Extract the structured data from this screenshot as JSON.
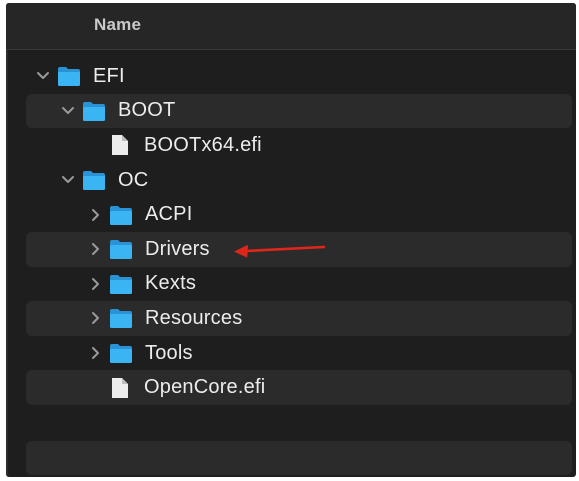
{
  "header": {
    "name_label": "Name"
  },
  "tree": [
    {
      "label": "EFI",
      "type": "folder",
      "expanded": true,
      "level": 0
    },
    {
      "label": "BOOT",
      "type": "folder",
      "expanded": true,
      "level": 1
    },
    {
      "label": "BOOTx64.efi",
      "type": "file",
      "level": 2
    },
    {
      "label": "OC",
      "type": "folder",
      "expanded": true,
      "level": 1
    },
    {
      "label": "ACPI",
      "type": "folder",
      "expanded": false,
      "level": 2
    },
    {
      "label": "Drivers",
      "type": "folder",
      "expanded": false,
      "level": 2
    },
    {
      "label": "Kexts",
      "type": "folder",
      "expanded": false,
      "level": 2
    },
    {
      "label": "Resources",
      "type": "folder",
      "expanded": false,
      "level": 2
    },
    {
      "label": "Tools",
      "type": "folder",
      "expanded": false,
      "level": 2
    },
    {
      "label": "OpenCore.efi",
      "type": "file",
      "level": 2
    }
  ],
  "colors": {
    "background": "#1e1e1e",
    "row_alt": "#2b2b2b",
    "folder": "#3ab4f2",
    "text": "#ececec",
    "annotation_arrow": "#e0261b"
  },
  "annotation": {
    "points_to": "Drivers",
    "icon": "red-arrow-icon"
  }
}
